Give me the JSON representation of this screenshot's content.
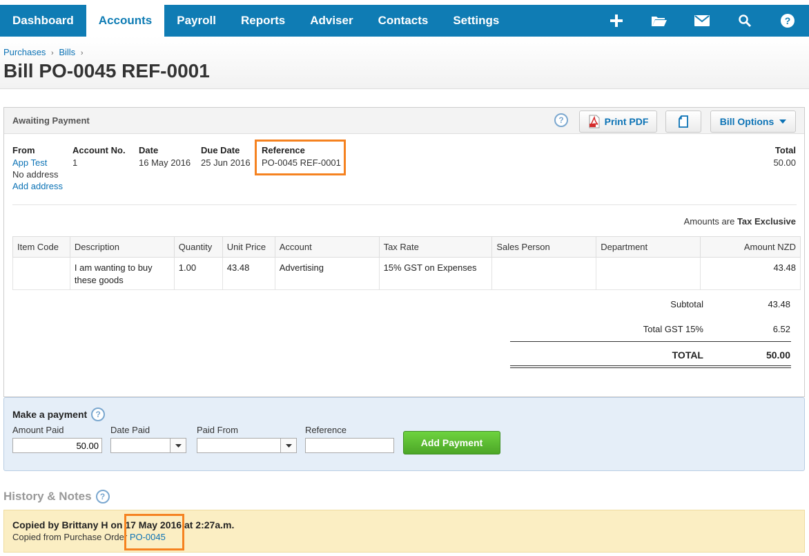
{
  "nav": {
    "items": [
      "Dashboard",
      "Accounts",
      "Payroll",
      "Reports",
      "Adviser",
      "Contacts",
      "Settings"
    ],
    "active": "Accounts",
    "icons": [
      "plus-icon",
      "folder-icon",
      "mail-icon",
      "search-icon",
      "help-icon"
    ]
  },
  "breadcrumb": {
    "item1": "Purchases",
    "item2": "Bills",
    "sep": "›"
  },
  "page_title": "Bill PO-0045 REF-0001",
  "bill": {
    "status": "Awaiting Payment",
    "print_pdf": "Print PDF",
    "bill_options": "Bill Options",
    "from_label": "From",
    "from_value": "App Test",
    "no_address": "No address",
    "add_address": "Add address",
    "account_no_label": "Account No.",
    "account_no_value": "1",
    "date_label": "Date",
    "date_value": "16 May 2016",
    "due_date_label": "Due Date",
    "due_date_value": "25 Jun 2016",
    "reference_label": "Reference",
    "reference_value": "PO-0045 REF-0001",
    "total_label": "Total",
    "total_value": "50.00",
    "amounts_are": "Amounts are",
    "tax_mode": "Tax Exclusive"
  },
  "table": {
    "headers": [
      "Item Code",
      "Description",
      "Quantity",
      "Unit Price",
      "Account",
      "Tax Rate",
      "Sales Person",
      "Department",
      "Amount NZD"
    ],
    "rows": [
      {
        "item_code": "",
        "description": "I am wanting to buy these goods",
        "quantity": "1.00",
        "unit_price": "43.48",
        "account": "Advertising",
        "tax_rate": "15% GST on Expenses",
        "sales_person": "",
        "department": "",
        "amount": "43.48"
      }
    ]
  },
  "totals": {
    "subtotal_label": "Subtotal",
    "subtotal_value": "43.48",
    "gst_label": "Total GST  15%",
    "gst_value": "6.52",
    "total_label": "TOTAL",
    "total_value": "50.00"
  },
  "payment": {
    "title": "Make a payment",
    "amount_label": "Amount Paid",
    "amount_value": "50.00",
    "date_label": "Date Paid",
    "date_value": "",
    "paid_from_label": "Paid From",
    "paid_from_value": "",
    "reference_label": "Reference",
    "reference_value": "",
    "add_button": "Add Payment"
  },
  "history": {
    "title": "History & Notes",
    "line1": "Copied by Brittany H on 17 May 2016 at 2:27a.m.",
    "line2_prefix": "Copied from Purchase Order",
    "line2_link": "PO-0045"
  },
  "colors": {
    "nav_bg": "#0f7cb4",
    "link": "#0b72b5",
    "highlight": "#f58220",
    "add_payment": "#58b830",
    "history_bg": "#fbeec3",
    "payment_bg": "#e5eef8"
  }
}
